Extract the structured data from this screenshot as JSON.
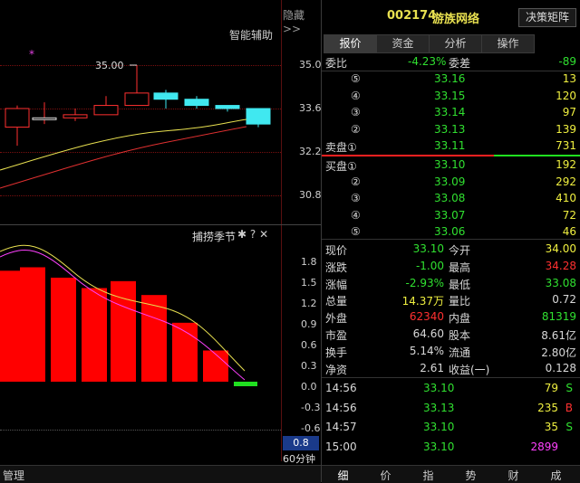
{
  "left": {
    "hide_label": "隐藏>>",
    "assist_label": "智能辅助",
    "price_callout": "35.00",
    "price_axis": [
      "35.0",
      "33.6",
      "32.2",
      "30.8"
    ],
    "indicator_title": "捕捞季节",
    "indicator_axis": [
      "1.8",
      "1.5",
      "1.2",
      "0.9",
      "0.6",
      "0.3",
      "0.0",
      "-0.3",
      "-0.6"
    ],
    "current_value": "0.8",
    "period": "60分钟",
    "manage": "管理",
    "candles": [
      {
        "o": 33.0,
        "c": 33.6,
        "h": 33.7,
        "l": 32.4
      },
      {
        "o": 33.3,
        "c": 33.3,
        "h": 33.8,
        "l": 33.1
      },
      {
        "o": 33.3,
        "c": 33.4,
        "h": 33.6,
        "l": 33.2
      },
      {
        "o": 33.4,
        "c": 33.7,
        "h": 34.0,
        "l": 33.4
      },
      {
        "o": 33.7,
        "c": 34.1,
        "h": 35.0,
        "l": 33.7
      },
      {
        "o": 34.1,
        "c": 33.9,
        "h": 34.2,
        "l": 33.6
      },
      {
        "o": 33.9,
        "c": 33.7,
        "h": 34.0,
        "l": 33.6
      },
      {
        "o": 33.7,
        "c": 33.6,
        "h": 33.7,
        "l": 33.5
      },
      {
        "o": 33.6,
        "c": 33.1,
        "h": 33.6,
        "l": 33.0
      }
    ],
    "hist_values": [
      1.6,
      1.65,
      1.5,
      1.35,
      1.45,
      1.25,
      0.85,
      0.45,
      -0.02
    ]
  },
  "right": {
    "code": "002174",
    "name": "游族网络",
    "decision_btn": "决策矩阵",
    "tabs": [
      "报价",
      "资金",
      "分析",
      "操作"
    ],
    "weibi_label": "委比",
    "weibi_value": "-4.23%",
    "weicha_label": "委差",
    "weicha_value": "-89",
    "sell": [
      {
        "n": "⑤",
        "price": "33.16",
        "vol": "13"
      },
      {
        "n": "④",
        "price": "33.15",
        "vol": "120"
      },
      {
        "n": "③",
        "price": "33.14",
        "vol": "97"
      },
      {
        "n": "②",
        "price": "33.13",
        "vol": "139"
      },
      {
        "n": "卖盘①",
        "price": "33.11",
        "vol": "731"
      }
    ],
    "buy": [
      {
        "n": "买盘①",
        "price": "33.10",
        "vol": "192"
      },
      {
        "n": "②",
        "price": "33.09",
        "vol": "292"
      },
      {
        "n": "③",
        "price": "33.08",
        "vol": "410"
      },
      {
        "n": "④",
        "price": "33.07",
        "vol": "72"
      },
      {
        "n": "⑤",
        "price": "33.06",
        "vol": "46"
      }
    ],
    "stats": [
      {
        "l1": "现价",
        "v1": "33.10",
        "c1": "dn",
        "l2": "今开",
        "v2": "34.00",
        "c2": "yl"
      },
      {
        "l1": "涨跌",
        "v1": "-1.00",
        "c1": "dn",
        "l2": "最高",
        "v2": "34.28",
        "c2": "up"
      },
      {
        "l1": "涨幅",
        "v1": "-2.93%",
        "c1": "dn",
        "l2": "最低",
        "v2": "33.08",
        "c2": "dn"
      },
      {
        "l1": "总量",
        "v1": "14.37万",
        "c1": "yl",
        "l2": "量比",
        "v2": "0.72",
        "c2": "wh"
      },
      {
        "l1": "外盘",
        "v1": "62340",
        "c1": "up",
        "l2": "内盘",
        "v2": "81319",
        "c2": "dn"
      },
      {
        "l1": "市盈",
        "v1": "64.60",
        "c1": "wh",
        "l2": "股本",
        "v2": "8.61亿",
        "c2": "wh"
      },
      {
        "l1": "换手",
        "v1": "5.14%",
        "c1": "wh",
        "l2": "流通",
        "v2": "2.80亿",
        "c2": "wh"
      },
      {
        "l1": "净资",
        "v1": "2.61",
        "c1": "wh",
        "l2": "收益(一)",
        "v2": "0.128",
        "c2": "wh"
      }
    ],
    "ticks": [
      {
        "t": "14:56",
        "p": "33.10",
        "v": "79",
        "s": "S",
        "vc": "yl",
        "sc": "dn"
      },
      {
        "t": "14:56",
        "p": "33.13",
        "v": "235",
        "s": "B",
        "vc": "yl",
        "sc": "up"
      },
      {
        "t": "14:57",
        "p": "33.10",
        "v": "35",
        "s": "S",
        "vc": "yl",
        "sc": "dn"
      },
      {
        "t": "15:00",
        "p": "33.10",
        "v": "2899",
        "s": "",
        "vc": "mg",
        "sc": "dn"
      }
    ],
    "bottom_tabs": [
      "细",
      "价",
      "指",
      "势",
      "财",
      "成"
    ]
  }
}
